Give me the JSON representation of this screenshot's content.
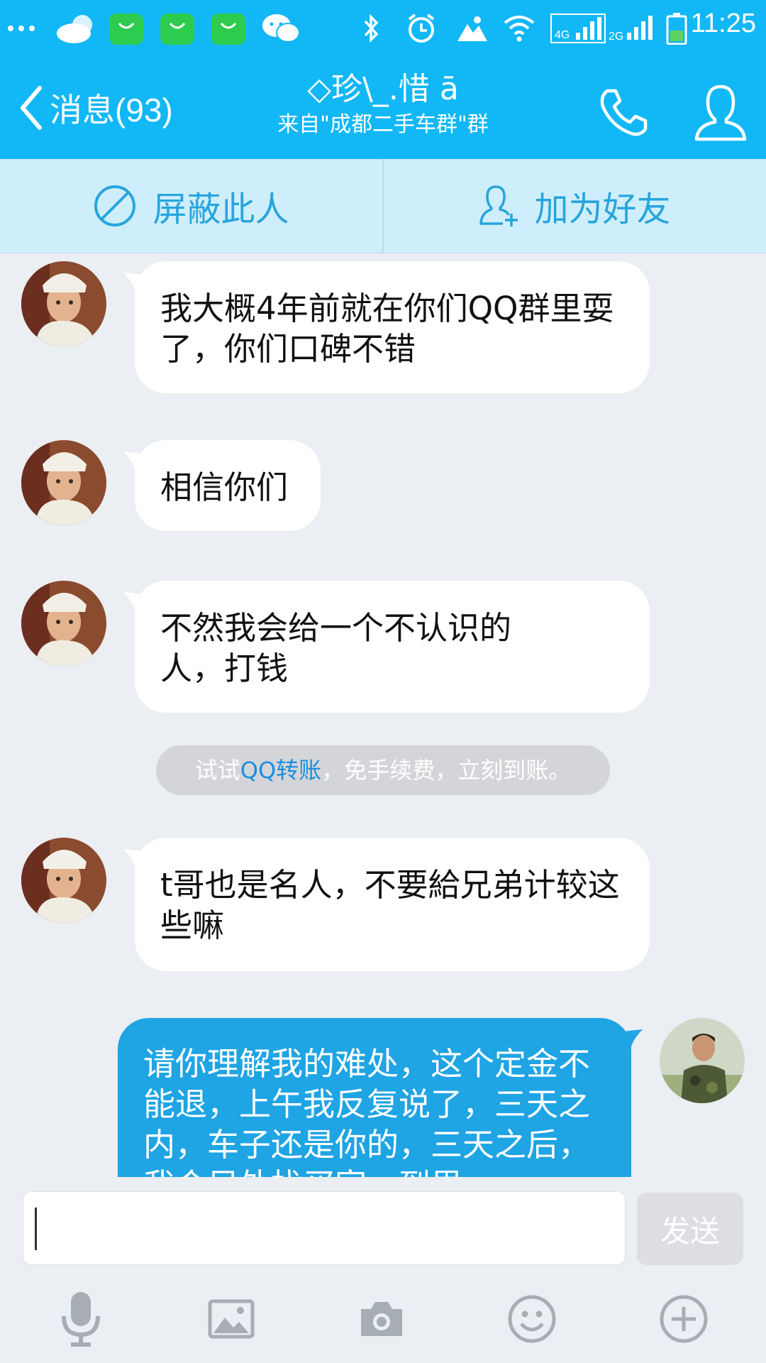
{
  "status_bar": {
    "time": "11:25",
    "network_4g": "4G",
    "network_2g": "2G",
    "icons": [
      "more-icon",
      "cloud-weather-icon",
      "shop-bag-icon",
      "shop-bag-icon",
      "shop-bag-icon",
      "wechat-icon",
      "bluetooth-icon",
      "alarm-icon",
      "data-transfer-icon",
      "wifi-icon",
      "signal-4g-icon",
      "signal-2g-icon",
      "battery-icon"
    ]
  },
  "header": {
    "back_label": "消息(93)",
    "title": "◇珍\\_.惜 ā",
    "subtitle": "来自\"成都二手车群\"群",
    "call_icon": "phone-icon",
    "profile_icon": "person-icon"
  },
  "action_bar": {
    "block_label": "屏蔽此人",
    "add_friend_label": "加为好友"
  },
  "messages": [
    {
      "direction": "in",
      "text": "我大概4年前就在你们QQ群里耍了，你们口碑不错"
    },
    {
      "direction": "in",
      "text": "相信你们"
    },
    {
      "direction": "in",
      "text": "不然我会给一个不认识的人，打钱"
    },
    {
      "direction": "in",
      "text": "t哥也是名人，不要給兄弟计较这些嘛"
    },
    {
      "direction": "out",
      "text": "请你理解我的难处，这个定金不能退，上午我反复说了，三天之内，车子还是你的，三天之后，我会另外找买家，到里"
    }
  ],
  "system_tip": {
    "prefix": "试试",
    "link": "QQ转账",
    "suffix": "，免手续费，立刻到账。"
  },
  "input": {
    "value": "",
    "send_label": "发送"
  },
  "toolbar": {
    "icons": [
      "microphone-icon",
      "image-icon",
      "camera-icon",
      "emoji-icon",
      "plus-icon"
    ]
  },
  "colors": {
    "brand": "#12b7f5",
    "outgoing_bubble": "#1fa4e4",
    "incoming_bubble": "#ffffff",
    "action_bar_bg": "#cfeefb",
    "action_text": "#27a5dd",
    "chat_bg": "#ebeef2"
  }
}
